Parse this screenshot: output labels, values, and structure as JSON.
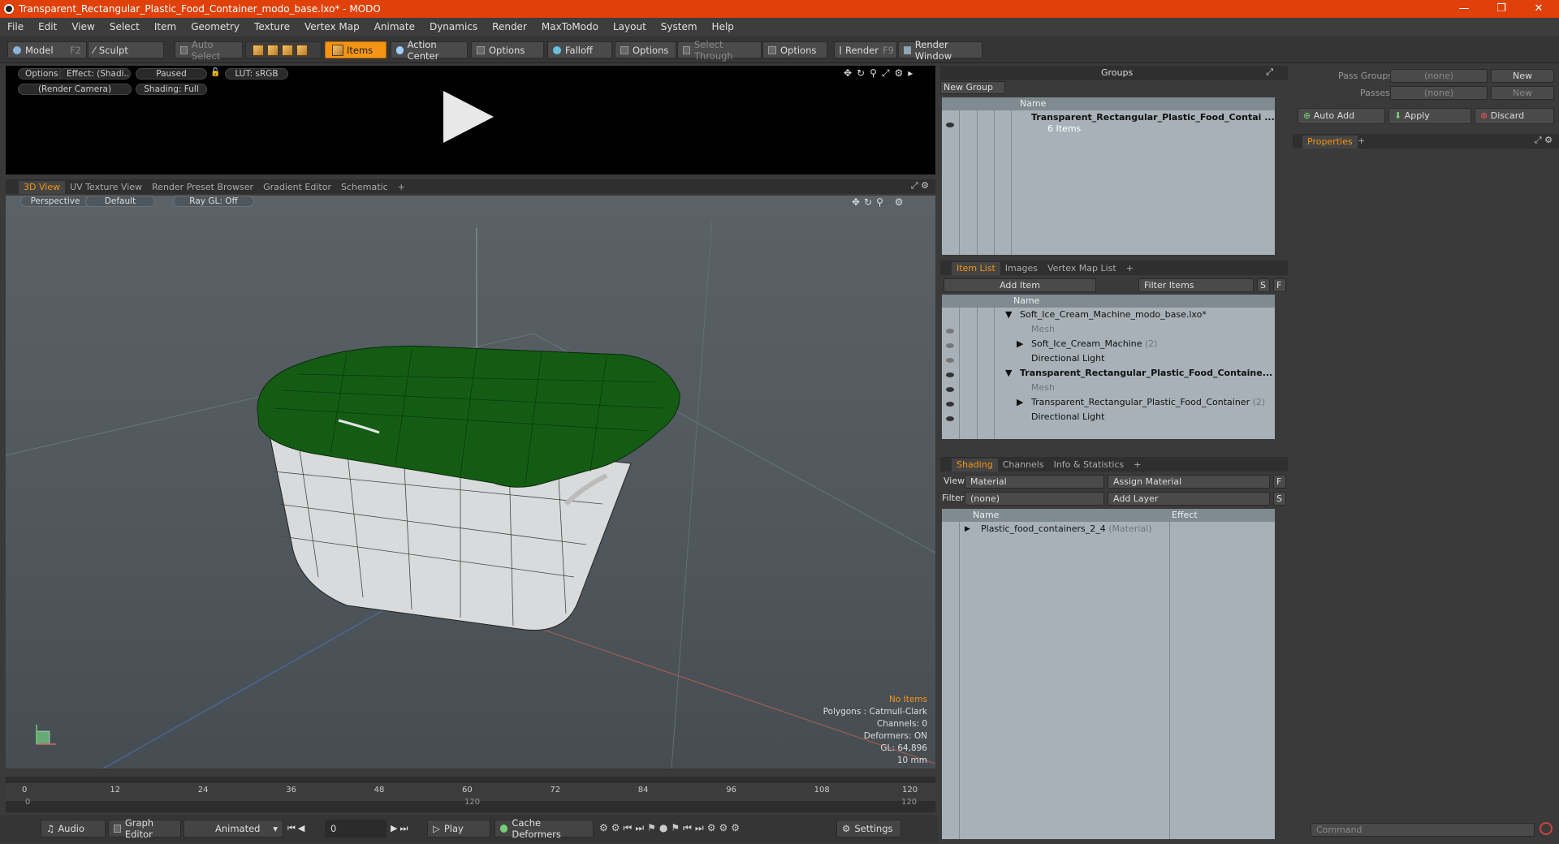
{
  "window": {
    "title": "Transparent_Rectangular_Plastic_Food_Container_modo_base.lxo* - MODO",
    "controls": [
      "—",
      "❐",
      "✕"
    ]
  },
  "menu": [
    "File",
    "Edit",
    "View",
    "Select",
    "Item",
    "Geometry",
    "Texture",
    "Vertex Map",
    "Animate",
    "Dynamics",
    "Render",
    "MaxToModo",
    "Layout",
    "System",
    "Help"
  ],
  "toolbar": {
    "model": "Model",
    "model_key": "F2",
    "sculpt": "Sculpt",
    "auto_select": "Auto Select",
    "items": "Items",
    "action_center": "Action Center",
    "options1": "Options",
    "falloff": "Falloff",
    "options2": "Options",
    "select_through": "Select Through",
    "options3": "Options",
    "render": "Render",
    "render_key": "F9",
    "render_window": "Render Window"
  },
  "preview": {
    "options": "Options",
    "effect": "Effect: (Shadi...",
    "paused": "Paused",
    "lut": "LUT: sRGB",
    "camera": "(Render Camera)",
    "shading": "Shading: Full"
  },
  "viewport_tabs": [
    "3D View",
    "UV Texture View",
    "Render Preset Browser",
    "Gradient Editor",
    "Schematic",
    "+"
  ],
  "viewport": {
    "perspective": "Perspective",
    "default": "Default",
    "raygl": "Ray GL: Off",
    "info": {
      "items": "No Items",
      "polygons": "Polygons : Catmull-Clark",
      "channels": "Channels: 0",
      "deformers": "Deformers: ON",
      "gl": "GL: 64,896",
      "scale": "10 mm"
    }
  },
  "timeline": {
    "ticks": [
      "0",
      "12",
      "24",
      "36",
      "48",
      "60",
      "72",
      "84",
      "96",
      "108",
      "120"
    ],
    "sub": [
      "0",
      "120",
      "120"
    ]
  },
  "bottom": {
    "audio": "Audio",
    "graph_editor": "Graph Editor",
    "animated": "Animated",
    "frame": "0",
    "play": "Play",
    "cache_deformers": "Cache Deformers",
    "settings": "Settings"
  },
  "groups": {
    "title": "Groups",
    "new_group": "New Group",
    "col_name": "Name",
    "item_name": "Transparent_Rectangular_Plastic_Food_Contai ...",
    "item_count": "6 Items"
  },
  "item_list": {
    "tabs": [
      "Item List",
      "Images",
      "Vertex Map List",
      "+"
    ],
    "add_item": "Add Item",
    "filter": "Filter Items",
    "s": "S",
    "f": "F",
    "col_name": "Name",
    "rows": [
      {
        "label": "Soft_Ice_Cream_Machine_modo_base.lxo*",
        "suffix": ""
      },
      {
        "label": "Mesh",
        "suffix": ""
      },
      {
        "label": "Soft_Ice_Cream_Machine",
        "suffix": "(2)"
      },
      {
        "label": "Directional Light",
        "suffix": ""
      },
      {
        "label": "Transparent_Rectangular_Plastic_Food_Containe...",
        "suffix": ""
      },
      {
        "label": "Mesh",
        "suffix": ""
      },
      {
        "label": "Transparent_Rectangular_Plastic_Food_Container",
        "suffix": "(2)"
      },
      {
        "label": "Directional Light",
        "suffix": ""
      }
    ]
  },
  "shading": {
    "tabs": [
      "Shading",
      "Channels",
      "Info & Statistics",
      "+"
    ],
    "view_label": "View",
    "view_value": "Material",
    "assign_material": "Assign Material",
    "filter_label": "Filter",
    "filter_value": "(none)",
    "add_layer": "Add Layer",
    "f": "F",
    "s": "S",
    "col_name": "Name",
    "col_effect": "Effect",
    "material": "Plastic_food_containers_2_4",
    "material_type": "(Material)"
  },
  "right_panel": {
    "pass_groups": "Pass Groups",
    "passes": "Passes",
    "none1": "(none)",
    "none2": "(none)",
    "new1": "New",
    "new2": "New",
    "auto_add": "Auto Add",
    "apply": "Apply",
    "discard": "Discard",
    "properties": "Properties",
    "plus": "+",
    "command": "Command"
  }
}
